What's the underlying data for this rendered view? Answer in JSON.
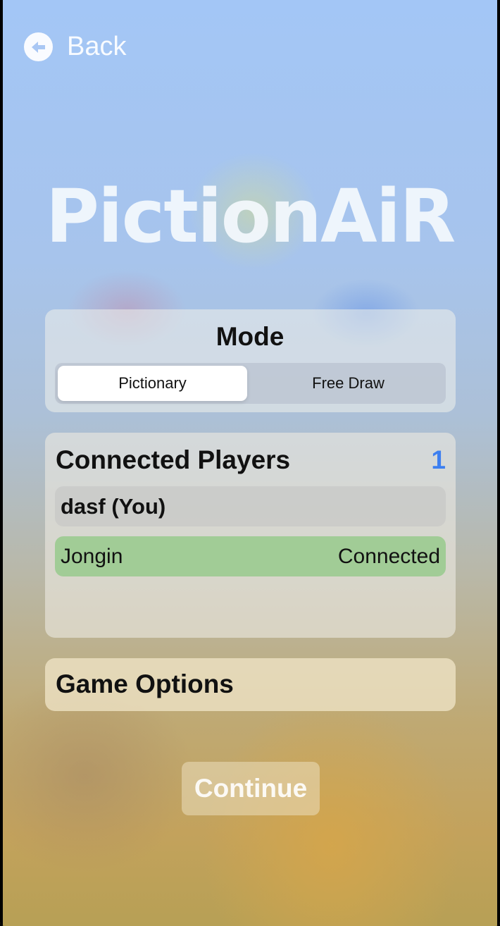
{
  "nav": {
    "back_label": "Back",
    "back_icon": "arrow-left-circle-icon"
  },
  "app": {
    "title": "PictionAiR"
  },
  "mode": {
    "heading": "Mode",
    "options": [
      "Pictionary",
      "Free Draw"
    ],
    "selected": "Pictionary"
  },
  "players": {
    "heading": "Connected Players",
    "count": "1",
    "count_color": "#3d7ff0",
    "self": {
      "name": "dasf (You)"
    },
    "list": [
      {
        "name": "Jongin",
        "status": "Connected",
        "color": "#a1cc96"
      }
    ]
  },
  "options": {
    "heading": "Game Options"
  },
  "actions": {
    "continue_label": "Continue"
  }
}
